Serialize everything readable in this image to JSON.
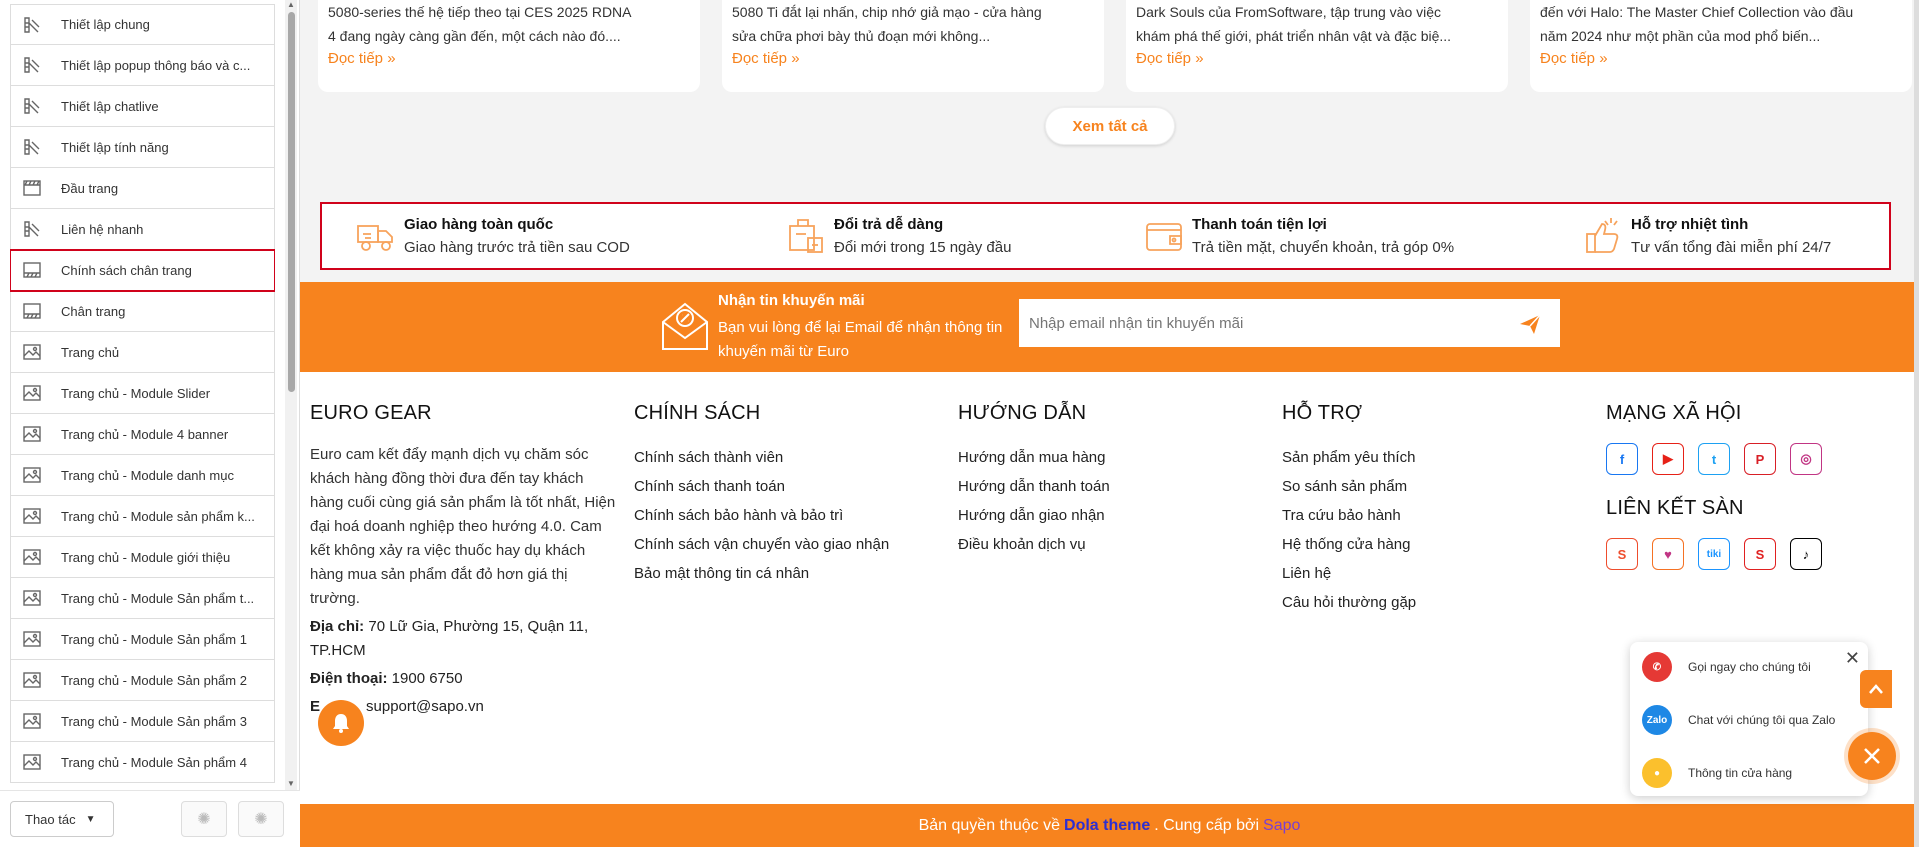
{
  "sidebar": {
    "items": [
      {
        "label": "Thiết lập chung",
        "icon": "settings-brush-icon"
      },
      {
        "label": "Thiết lập popup thông báo và c...",
        "icon": "settings-brush-icon"
      },
      {
        "label": "Thiết lập chatlive",
        "icon": "settings-brush-icon"
      },
      {
        "label": "Thiết lập tính năng",
        "icon": "settings-brush-icon"
      },
      {
        "label": "Đầu trang",
        "icon": "header-layout-icon"
      },
      {
        "label": "Liên hệ nhanh",
        "icon": "settings-brush-icon"
      },
      {
        "label": "Chính sách chân trang",
        "icon": "footer-layout-icon",
        "selected": true
      },
      {
        "label": "Chân trang",
        "icon": "footer-layout-icon"
      },
      {
        "label": "Trang chủ",
        "icon": "image-section-icon"
      },
      {
        "label": "Trang chủ - Module Slider",
        "icon": "image-section-icon"
      },
      {
        "label": "Trang chủ - Module 4 banner",
        "icon": "image-section-icon"
      },
      {
        "label": "Trang chủ - Module danh mục",
        "icon": "image-section-icon"
      },
      {
        "label": "Trang chủ - Module sản phẩm k...",
        "icon": "image-section-icon"
      },
      {
        "label": "Trang chủ - Module giới thiệu",
        "icon": "image-section-icon"
      },
      {
        "label": "Trang chủ - Module Sản phẩm t...",
        "icon": "image-section-icon"
      },
      {
        "label": "Trang chủ - Module Sản phẩm 1",
        "icon": "image-section-icon"
      },
      {
        "label": "Trang chủ - Module Sản phẩm 2",
        "icon": "image-section-icon"
      },
      {
        "label": "Trang chủ - Module Sản phẩm 3",
        "icon": "image-section-icon"
      },
      {
        "label": "Trang chủ - Module Sản phẩm 4",
        "icon": "image-section-icon"
      }
    ],
    "action_label": "Thao tác"
  },
  "blog_cards": [
    {
      "excerpt_1": "5080-series thế hệ tiếp theo tại CES 2025 RDNA",
      "excerpt_2": "4 đang ngày càng gần đến, một cách nào đó....",
      "read_more": "Đọc tiếp"
    },
    {
      "excerpt_1": "5080 Ti đắt lại nhấn, chip nhớ giả mạo - cửa hàng",
      "excerpt_2": "sửa chữa phơi bày thủ đoạn mới không...",
      "read_more": "Đọc tiếp"
    },
    {
      "excerpt_1": "Dark Souls của FromSoftware, tập trung vào việc",
      "excerpt_2": "khám phá thế giới, phát triển nhân vật và đặc biệ...",
      "read_more": "Đọc tiếp"
    },
    {
      "excerpt_1": "đến với Halo: The Master Chief Collection vào đầu",
      "excerpt_2": "năm 2024 như một phần của mod phổ biến...",
      "read_more": "Đọc tiếp"
    }
  ],
  "see_all": "Xem tất cả",
  "policies": [
    {
      "title": "Giao hàng toàn quốc",
      "desc": "Giao hàng trước trả tiền sau COD",
      "icon": "delivery-truck-icon"
    },
    {
      "title": "Đổi trả dễ dàng",
      "desc": "Đổi mới trong 15 ngày đầu",
      "icon": "return-box-icon"
    },
    {
      "title": "Thanh toán tiện lợi",
      "desc": "Trả tiền mặt, chuyển khoản, trả góp 0%",
      "icon": "wallet-icon"
    },
    {
      "title": "Hỗ trợ nhiệt tình",
      "desc": "Tư vấn tổng đài miễn phí 24/7",
      "icon": "thumbs-up-icon"
    }
  ],
  "newsletter": {
    "title": "Nhận tin khuyến mãi",
    "desc": "Bạn vui lòng để lại Email để nhận thông tin khuyến mãi từ Euro",
    "placeholder": "Nhập email nhận tin khuyến mãi"
  },
  "footer": {
    "about": {
      "title": "EURO GEAR",
      "text": "Euro cam kết đẩy mạnh dịch vụ chăm sóc khách hàng đồng thời đưa đến tay khách hàng cuối cùng giá sản phẩm là tốt nhất, Hiện đại hoá doanh nghiệp theo hướng 4.0. Cam kết không xảy ra việc thuốc hay dụ khách hàng mua sản phẩm đắt đỏ hơn giá thị trường.",
      "address_label": "Địa chỉ:",
      "address": " 70 Lữ Gia, Phường 15, Quận 11, TP.HCM",
      "phone_label": "Điện thoại:",
      "phone": " 1900 6750",
      "email_label": "E",
      "email": "support@sapo.vn"
    },
    "policy": {
      "title": "CHÍNH SÁCH",
      "links": [
        "Chính sách thành viên",
        "Chính sách thanh toán",
        "Chính sách bảo hành và bảo trì",
        "Chính sách vận chuyển vào giao nhận",
        "Bảo mật thông tin cá nhân"
      ]
    },
    "guide": {
      "title": "HƯỚNG DẪN",
      "links": [
        "Hướng dẫn mua hàng",
        "Hướng dẫn thanh toán",
        "Hướng dẫn giao nhận",
        "Điều khoản dịch vụ"
      ]
    },
    "support": {
      "title": "HỖ TRỢ",
      "links": [
        "Sản phẩm yêu thích",
        "So sánh sản phẩm",
        "Tra cứu bảo hành",
        "Hệ thống cửa hàng",
        "Liên hệ",
        "Câu hỏi thường gặp"
      ]
    },
    "social": {
      "title": "MẠNG XÃ HỘI",
      "market_title": "LIÊN KẾT SÀN"
    }
  },
  "copyright": {
    "prefix": "Bản quyền thuộc về",
    "brand": "Dola theme",
    "middle": ". Cung cấp bởi",
    "provider": "Sapo"
  },
  "contact_popup": {
    "call": "Gọi ngay cho chúng tôi",
    "zalo": "Chat với chúng tôi qua Zalo",
    "store": "Thông tin cửa hàng",
    "zalo_badge": "Zalo"
  },
  "colors": {
    "accent": "#f7831e",
    "highlight": "#d0021b"
  }
}
